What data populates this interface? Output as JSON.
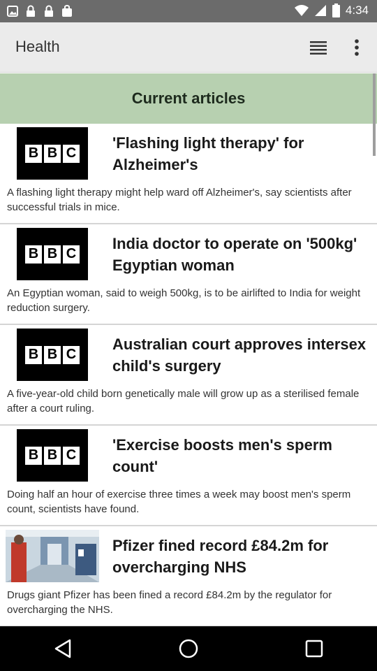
{
  "status_bar": {
    "time": "4:34",
    "left_icons": [
      "image-icon",
      "lock-icon",
      "lock-icon",
      "bag-icon"
    ],
    "right_icons": [
      "wifi-icon",
      "signal-icon",
      "battery-icon"
    ]
  },
  "app_bar": {
    "title": "Health",
    "actions": [
      "list-view-icon",
      "more-vert-icon"
    ]
  },
  "section": {
    "title": "Current articles"
  },
  "articles": [
    {
      "thumb": "bbc-logo",
      "headline": "'Flashing light therapy' for Alzheimer's",
      "summary": "A flashing light therapy might help ward off Alzheimer's, say scientists after successful trials in mice."
    },
    {
      "thumb": "bbc-logo",
      "headline": "India doctor to operate on '500kg' Egyptian woman",
      "summary": "An Egyptian woman, said to weigh 500kg, is to be airlifted to India for weight reduction surgery."
    },
    {
      "thumb": "bbc-logo",
      "headline": "Australian court approves intersex child's surgery",
      "summary": "A five-year-old child born genetically male will grow up as a sterilised female after a court ruling."
    },
    {
      "thumb": "bbc-logo",
      "headline": "'Exercise boosts men's sperm count'",
      "summary": "Doing half an hour of exercise three times a week may boost men's sperm count, scientists have found."
    },
    {
      "thumb": "hospital-photo",
      "headline": "Pfizer fined record £84.2m for overcharging NHS",
      "summary": "Drugs giant Pfizer has been fined a record £84.2m by the regulator for overcharging the NHS."
    }
  ],
  "bbc_letters": [
    "B",
    "B",
    "C"
  ],
  "nav_bar": {
    "buttons": [
      "back-icon",
      "home-icon",
      "recents-icon"
    ]
  },
  "colors": {
    "status_bar": "#6b6b6b",
    "app_bar": "#ebebeb",
    "section_header": "#b7d0b0",
    "nav_bar": "#000000"
  }
}
